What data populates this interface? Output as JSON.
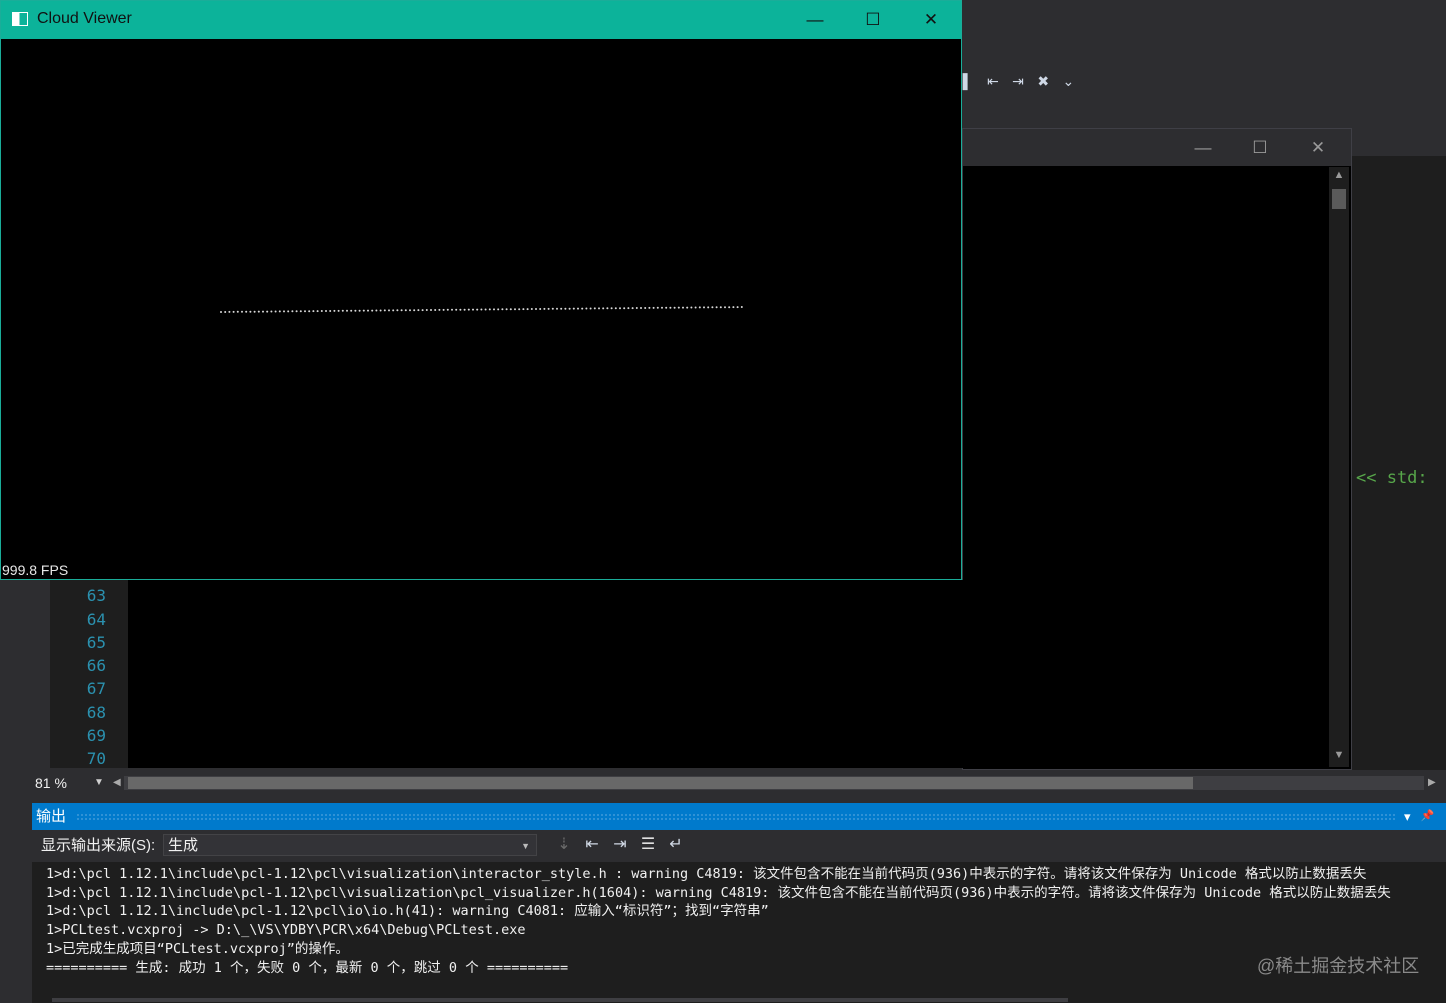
{
  "viewer": {
    "title": "Cloud Viewer",
    "fps_text": "999.8 FPS",
    "controls": {
      "minimize": "—",
      "maximize": "☐",
      "close": "✕"
    }
  },
  "console": {
    "controls": {
      "minimize": "—",
      "maximize": "☐",
      "close": "✕"
    },
    "scroll_up": "▲",
    "scroll_down": "▼"
  },
  "ide": {
    "right_code": "<< std:",
    "toolbar_icons": [
      "bookmark-icon",
      "prev-bookmark-icon",
      "next-bookmark-icon",
      "clear-bookmarks-icon",
      "overflow-icon"
    ],
    "toolbar_glyphs": [
      "▌",
      "⇤",
      "⇥",
      "✖",
      "⌄"
    ]
  },
  "editor": {
    "line_numbers": [
      "63",
      "64",
      "65",
      "66",
      "67",
      "68",
      "69",
      "70"
    ],
    "zoom": "81 %",
    "zoom_caret": "▼",
    "hscroll_left": "◀",
    "hscroll_right": "▶"
  },
  "output": {
    "title": "输出",
    "header_icons": [
      "▾",
      "📌"
    ],
    "source_label": "显示输出来源(S):",
    "source_value": "生成",
    "source_caret": "▼",
    "tool_glyphs": [
      "⇣",
      "⇤",
      "⇥",
      "☰",
      "↵"
    ],
    "lines": [
      "1>d:\\pcl 1.12.1\\include\\pcl-1.12\\pcl\\visualization\\interactor_style.h : warning C4819: 该文件包含不能在当前代码页(936)中表示的字符。请将该文件保存为 Unicode 格式以防止数据丢失",
      "1>d:\\pcl 1.12.1\\include\\pcl-1.12\\pcl\\visualization\\pcl_visualizer.h(1604): warning C4819: 该文件包含不能在当前代码页(936)中表示的字符。请将该文件保存为 Unicode 格式以防止数据丢失",
      "1>d:\\pcl 1.12.1\\include\\pcl-1.12\\pcl\\io\\io.h(41): warning C4081: 应输入“标识符”；找到“字符串”",
      "1>PCLtest.vcxproj -> D:\\_\\VS\\YDBY\\PCR\\x64\\Debug\\PCLtest.exe",
      "1>已完成生成项目“PCLtest.vcxproj”的操作。",
      "========== 生成: 成功 1 个，失败 0 个，最新 0 个，跳过 0 个 =========="
    ],
    "watermark": "@稀土掘金技术社区"
  },
  "colors": {
    "viewer_titlebar": "#0cb39a",
    "output_header": "#007acc",
    "line_number": "#2b91af",
    "ide_bg": "#2d2d30"
  }
}
